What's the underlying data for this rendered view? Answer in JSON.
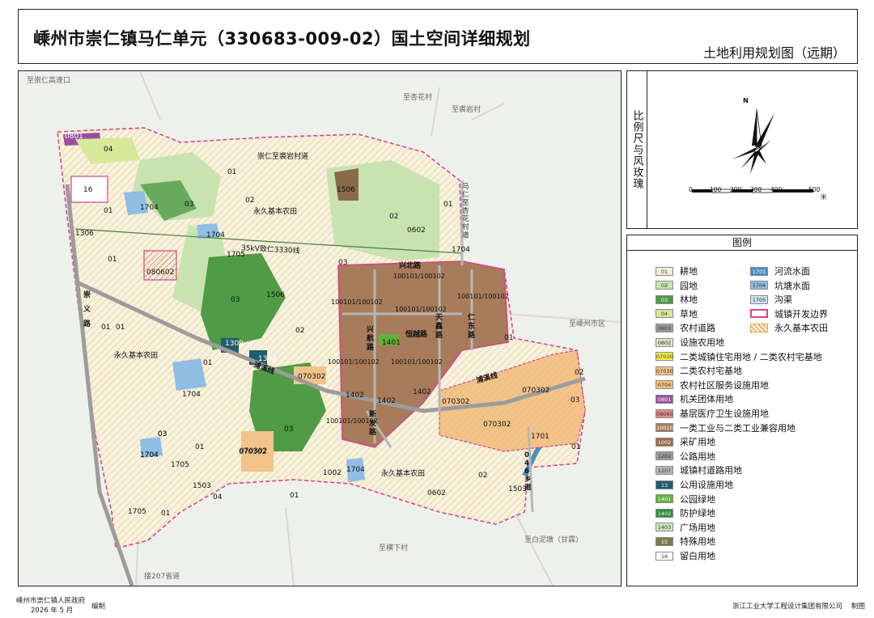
{
  "header": {
    "title": "嵊州市崇仁镇马仁单元（330683-009-02）国土空间详细规划",
    "subtitle": "土地利用规划图（远期）"
  },
  "compass": {
    "label": "比例尺与风玫瑰",
    "north": "N",
    "scale_ticks": [
      "0",
      "100",
      "200",
      "300",
      "400",
      "500"
    ],
    "scale_unit": "米"
  },
  "legend": {
    "title": "图例",
    "items": [
      {
        "code": "01",
        "label": "耕地",
        "color": "#f3f0da"
      },
      {
        "code": "02",
        "label": "园地",
        "color": "#c9e3b0"
      },
      {
        "code": "03",
        "label": "林地",
        "color": "#4f9b46"
      },
      {
        "code": "04",
        "label": "草地",
        "color": "#d7e89a"
      },
      {
        "code": "0601",
        "label": "农村道路",
        "color": "#9a9a9a"
      },
      {
        "code": "0602",
        "label": "设施农用地",
        "color": "#dde5c4"
      },
      {
        "code": "070301/070302",
        "label": "二类城镇住宅用地 / 二类农村宅基地",
        "color": "#f6ef4a"
      },
      {
        "code": "070302",
        "label": "二类农村宅基地",
        "color": "#f2c48c"
      },
      {
        "code": "0704",
        "label": "农村社区服务设施用地",
        "color": "#f5c27a"
      },
      {
        "code": "0801",
        "label": "机关团体用地",
        "color": "#9b4fa0"
      },
      {
        "code": "080602",
        "label": "基层医疗卫生设施用地",
        "color": "#e58b8b"
      },
      {
        "code": "100101/100102",
        "label": "一类工业与二类工业兼容用地",
        "color": "#a87b5a"
      },
      {
        "code": "1002",
        "label": "采矿用地",
        "color": "#9a6a4a"
      },
      {
        "code": "1202",
        "label": "公路用地",
        "color": "#9c9c9c"
      },
      {
        "code": "1207",
        "label": "城镇村道路用地",
        "color": "#b7b7b7"
      },
      {
        "code": "13",
        "label": "公用设施用地",
        "color": "#1f5c6e"
      },
      {
        "code": "1401",
        "label": "公园绿地",
        "color": "#5fb33c"
      },
      {
        "code": "1402",
        "label": "防护绿地",
        "color": "#2f8a3b"
      },
      {
        "code": "1403",
        "label": "广场用地",
        "color": "#cfe6c2"
      },
      {
        "code": "15",
        "label": "特殊用地",
        "color": "#7b7b4a"
      },
      {
        "code": "16",
        "label": "留白用地",
        "color": "#ffffff"
      },
      {
        "code": "1701",
        "label": "河流水面",
        "color": "#4a8fc0"
      },
      {
        "code": "1704",
        "label": "坑塘水面",
        "color": "#8fbde3"
      },
      {
        "code": "1705",
        "label": "沟渠",
        "color": "#cfe2f1"
      },
      {
        "code": "",
        "label": "城镇开发边界",
        "color": "#d0458f"
      },
      {
        "code": "",
        "label": "永久基本农田",
        "color": "#f0a040"
      }
    ]
  },
  "map": {
    "directions": {
      "to_expressway": "至崇仁高速口",
      "to_xingcun": "至杏花村",
      "to_yuanyan": "至裘岩村",
      "to_shengzhou": "至嵊州市区",
      "to_heng": "至横下村",
      "to_baini": "至白泥墩（甘霖）",
      "to_207": "接207省道",
      "road_vertical": "马仁至杏花村道"
    },
    "roads": {
      "chongyan": "崇仁至裘岩村道",
      "power_line": "35kV致仁3330线",
      "chongyi": "崇义路",
      "pugxi": "浦溪线",
      "pugxi2": "浦溪线",
      "xingbei": "兴北路",
      "xinghang": "兴航路",
      "hengyue": "恒越路",
      "tianxin": "天鑫路",
      "rendong": "仁东路",
      "xinfa": "新发路",
      "route046": "046乡道"
    },
    "farmland_labels": [
      "永久基本农田",
      "永久基本农田",
      "永久基本农田"
    ],
    "parcels": {
      "p0801": "0801",
      "p04a": "04",
      "p16": "16",
      "p1306": "1306",
      "p1704a": "1704",
      "p03a": "03",
      "p02a": "02",
      "p01a": "01",
      "p01b": "01",
      "p1704b": "1704",
      "p1705a": "1705",
      "p1506": "1506",
      "p02b": "02",
      "p01c": "01",
      "p0602a": "0602",
      "p1704c": "1704",
      "p080602": "080602",
      "p01d": "01",
      "p03b": "03",
      "p1506b": "1506",
      "p02c": "02",
      "p03c": "03",
      "p01e": "01",
      "p1309": "1309",
      "p1304": "1304",
      "p01f": "01",
      "p1704d": "1704",
      "p03d": "03",
      "p070302a": "070302",
      "p070302b": "070302",
      "p1402a": "1402",
      "p1402b": "1402",
      "p1402c": "1402",
      "p1401": "1401",
      "ind1": "100101/100102",
      "ind2": "100101/100102",
      "ind3": "100101/100102",
      "ind4": "100101/100102",
      "ind5": "100101/100102",
      "ind6": "100101/100102",
      "ind7": "100101/100102",
      "p01g": "01",
      "p070302c": "070302",
      "p070302d": "070302",
      "p070302e": "070302",
      "p02d": "02",
      "p03e": "03",
      "p1701": "1701",
      "p01h": "01",
      "p03f": "03",
      "p1704e": "1704",
      "p1705b": "1705",
      "p01i": "01",
      "p1503a": "1503",
      "p04b": "04",
      "p1705c": "1705",
      "p01j": "01",
      "p070302f": "070302",
      "p1002": "1002",
      "p1704f": "1704",
      "p01k": "01",
      "p0602b": "0602",
      "p02e": "02",
      "p1503b": "1503",
      "p01l": "01",
      "p1704g": "1704",
      "p03g": "03"
    }
  },
  "footer": {
    "org": "嵊州市崇仁镇人民政府",
    "date": "2026 年 5 月",
    "role1": "编制",
    "maker": "浙江工业大学工程设计集团有限公司",
    "role2": "制图"
  }
}
